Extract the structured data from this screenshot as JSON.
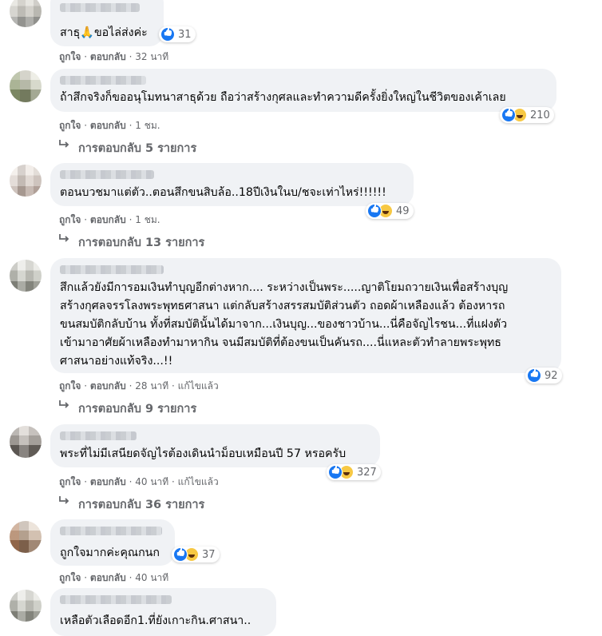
{
  "comments": [
    {
      "text": "สาธุ🙏ขอไล่ส่งค่ะ",
      "reaction_count": "31",
      "like_label": "ถูกใจ",
      "reply_label": "ตอบกลับ",
      "time": "32 นาที"
    },
    {
      "text": "ถ้าสึกจริงก็ขออนุโมทนาสาธุด้วย ถือว่าสร้างกุศลและทำความดีครั้งยิ่งใหญ่ในชีวิตของเค้าเลย",
      "reaction_count": "210",
      "like_label": "ถูกใจ",
      "reply_label": "ตอบกลับ",
      "time": "1 ชม.",
      "replies": "การตอบกลับ 5 รายการ"
    },
    {
      "text": "ตอนบวชมาแต่ตัว..ตอนสึกขนสิบล้อ..18ปีเงินในบ/ชจะเท่าไหร่!!!!!!",
      "reaction_count": "49",
      "like_label": "ถูกใจ",
      "reply_label": "ตอบกลับ",
      "time": "1 ชม.",
      "replies": "การตอบกลับ 13 รายการ"
    },
    {
      "lines": [
        "สึกแล้วยังมีการอมเงินทำบุญอีกต่างหาก.... ระหว่างเป็นพระ.....ญาติโยมถวายเงินเพื่อสร้างบุญ",
        "สร้างกุศลจรรโลงพระพุทธศาสนา แต่กลับสร้างสรรสมบัติส่วนตัว ถอดผ้าเหลืองแล้ว ต้องหารถ",
        "ขนสมบัติกลับบ้าน ทั้งที่สมบัตินั้นได้มาจาก...เงินบุญ...ของชาวบ้าน...นี่คือจัญไรชน...ที่แฝงตัว",
        "เข้ามาอาศัยผ้าเหลืองทำมาหากิน จนมีสมบัติที่ต้องขนเป็นคันรถ....นี่แหละตัวทำลายพระพุทธ",
        "ศาสนาอย่างแท้จริง...!!"
      ],
      "reaction_count": "92",
      "like_label": "ถูกใจ",
      "reply_label": "ตอบกลับ",
      "time": "28 นาที",
      "edited": "แก้ไขแล้ว",
      "replies": "การตอบกลับ 9 รายการ"
    },
    {
      "text": "พระที่ไม่มีเสนียดจัญไรต้องเดินนำม็อบเหมือนปี 57 หรอครับ",
      "reaction_count": "327",
      "like_label": "ถูกใจ",
      "reply_label": "ตอบกลับ",
      "time": "40 นาที",
      "edited": "แก้ไขแล้ว",
      "replies": "การตอบกลับ 36 รายการ"
    },
    {
      "text": "ถูกใจมากค่ะคุณกนก",
      "reaction_count": "37",
      "like_label": "ถูกใจ",
      "reply_label": "ตอบกลับ",
      "time": "40 นาที"
    },
    {
      "text": "เหลือตัวเลือดอีก1.ที่ยังเกาะกิน.ศาสนา.."
    }
  ],
  "separator": "·",
  "colors": {
    "bubble_bg": "#f0f2f5",
    "meta_text": "#65676b",
    "like_blue": "#1877f2",
    "haha_yellow": "#f7c843"
  },
  "icons": {
    "like": "like-reaction-icon",
    "haha": "haha-reaction-icon",
    "reply_arrow": "reply-arrow-icon"
  }
}
